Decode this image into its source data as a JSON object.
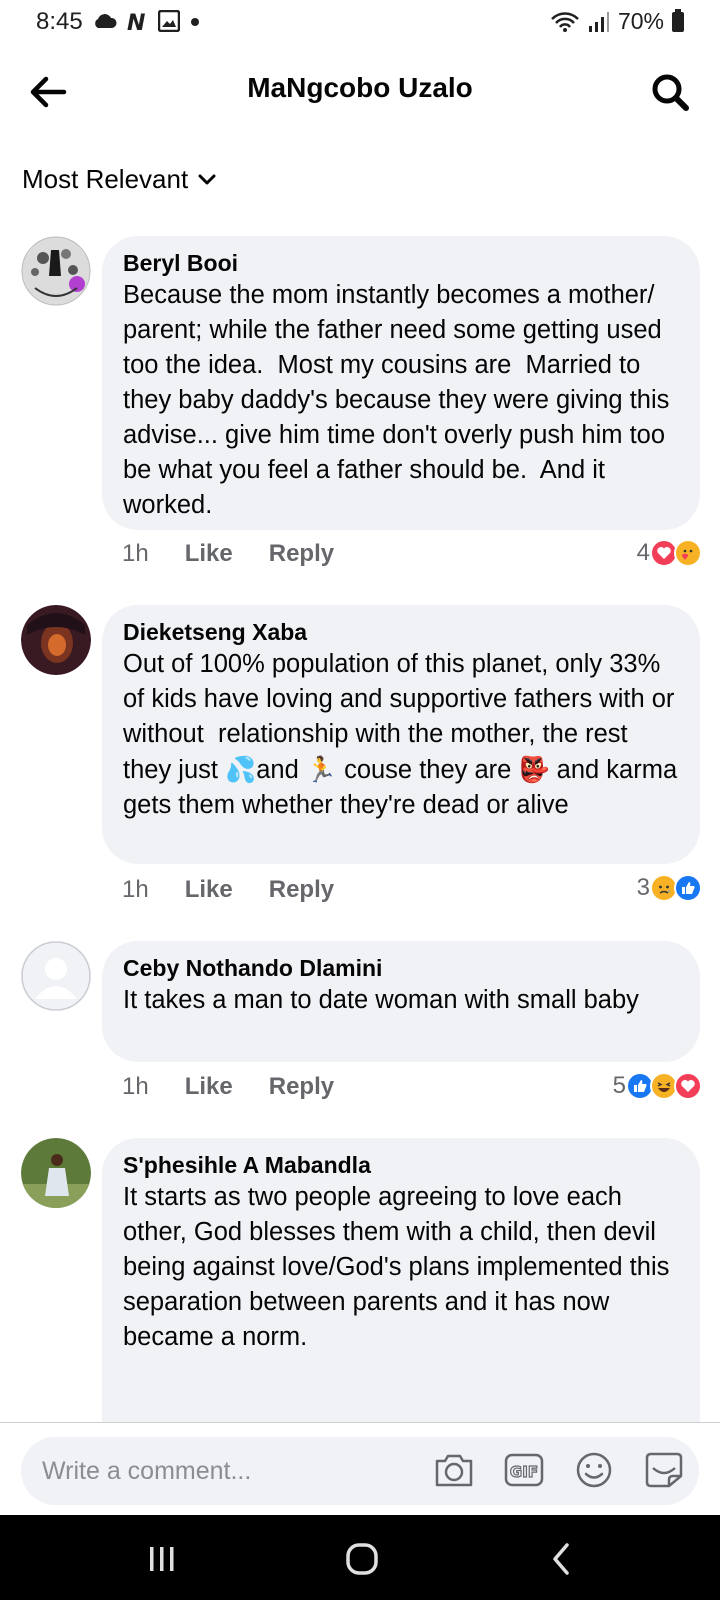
{
  "status_bar": {
    "time": "8:45",
    "battery": "70%",
    "icons": [
      "cloud-icon",
      "n-icon",
      "image-icon",
      "dot-icon",
      "wifi-icon",
      "signal-icon",
      "battery-icon"
    ]
  },
  "header": {
    "title": "MaNgcobo Uzalo",
    "back_icon": "back-arrow-icon",
    "search_icon": "search-icon"
  },
  "sort": {
    "label": "Most Relevant",
    "icon": "chevron-down-icon"
  },
  "comments": [
    {
      "author": "Beryl Booi",
      "text": "Because the mom instantly becomes a mother/ parent; while the father need some getting used too the idea.  Most my cousins are  Married to they baby daddy's because they were giving this advise... give him time don't overly push him too be what you feel a father should be.  And it worked.",
      "time": "1h",
      "like": "Like",
      "reply": "Reply",
      "reaction_count": "4",
      "reactions": [
        "love",
        "care"
      ]
    },
    {
      "author": "Dieketseng Xaba",
      "text_part1": "Out of 100% population of this planet, only 33% of kids have loving and supportive fathers with or without  relationship with the mother, the rest they just ",
      "emoji1": "💦",
      "text_part2": "and ",
      "emoji2": "🏃",
      "text_part3": " couse they are ",
      "emoji3": "👺",
      "text_part4": " and karma gets them whether they're dead or alive",
      "time": "1h",
      "like": "Like",
      "reply": "Reply",
      "reaction_count": "3",
      "reactions": [
        "sad",
        "like"
      ]
    },
    {
      "author": "Ceby Nothando Dlamini",
      "text": "It takes a man to date woman with small baby",
      "time": "1h",
      "like": "Like",
      "reply": "Reply",
      "reaction_count": "5",
      "reactions": [
        "like",
        "haha",
        "love"
      ]
    },
    {
      "author": "S'phesihle  A Mabandla",
      "text": "It starts as two people agreeing to love each other, God blesses them with a child, then devil being against love/God's plans implemented this separation between parents and it has now became a norm."
    }
  ],
  "composer": {
    "placeholder": "Write a comment...",
    "icons": [
      "camera-icon",
      "gif-icon",
      "emoji-icon",
      "sticker-icon"
    ],
    "gif_label": "GIF"
  },
  "colors": {
    "bubble": "#f0f2f5",
    "meta": "#65676b",
    "like_blue": "#1877f2",
    "love_red": "#f33e58",
    "emoji_yellow": "#f7b125"
  }
}
